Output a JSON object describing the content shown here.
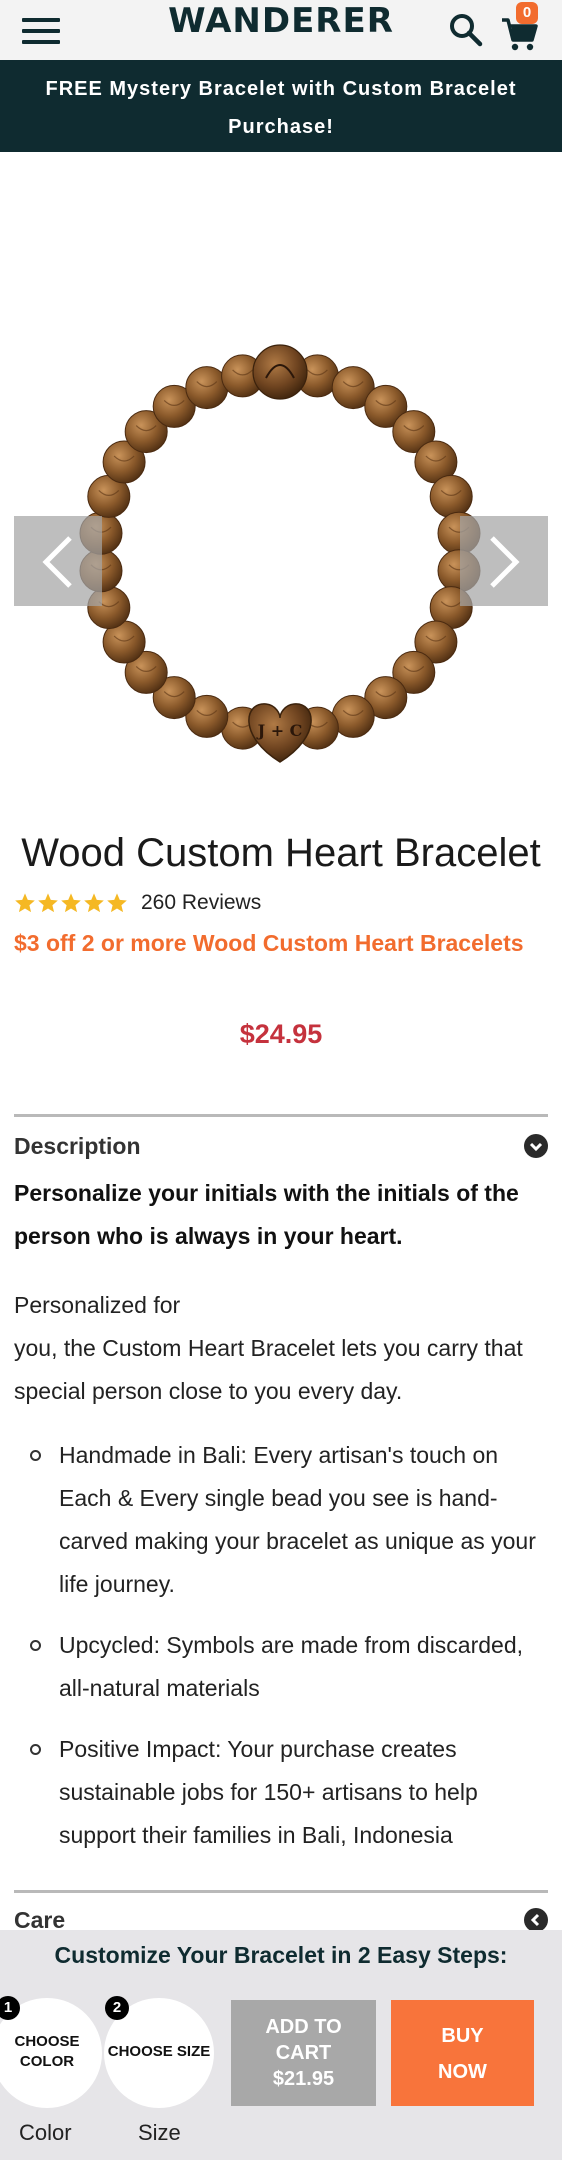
{
  "header": {
    "logo": "WANDERER",
    "cart_count": "0",
    "icons": [
      "hamburger-menu-icon",
      "search-icon",
      "cart-icon"
    ]
  },
  "promo": {
    "text": "FREE Mystery Bracelet with Custom Bracelet Purchase!"
  },
  "gallery": {
    "engraving": "J + C"
  },
  "product": {
    "title": "Wood Custom Heart Bracelet",
    "rating_stars": 5,
    "reviews_label": "260 Reviews",
    "offer": "$3 off 2 or more Wood Custom Heart Bracelets",
    "price": "$24.95"
  },
  "description": {
    "heading": "Description",
    "lead": "Personalize your initials with the initials of the person who is always in your heart.",
    "paragraph_line1": "Personalized for",
    "paragraph_line2": "you, the Custom Heart Bracelet lets you carry that special person close to you every day.",
    "bullets": [
      "Handmade in Bali: Every artisan's touch on Each & Every single bead you see is hand-carved making your bracelet as unique as your life journey.",
      "Upcycled: Symbols are made from discarded, all-natural materials",
      "Positive Impact: Your purchase creates sustainable jobs for 150+ artisans to help support their families in Bali, Indonesia"
    ]
  },
  "care": {
    "heading": "Care"
  },
  "sticky_bar": {
    "title": "Customize Your Bracelet in 2 Easy Steps:",
    "step1": {
      "number": "1",
      "line1": "CHOOSE",
      "line2": "COLOR",
      "caption": "Color"
    },
    "step2": {
      "number": "2",
      "label": "CHOOSE SIZE",
      "caption": "Size"
    },
    "add_to_cart": {
      "line1": "ADD TO",
      "line2": "CART",
      "price": "$21.95"
    },
    "buy_now": {
      "line1": "BUY",
      "line2": "NOW"
    }
  },
  "colors": {
    "brand_dark": "#0f2b30",
    "accent_orange": "#f26c2e",
    "price_red": "#c5323d",
    "star_gold": "#f5b823"
  }
}
